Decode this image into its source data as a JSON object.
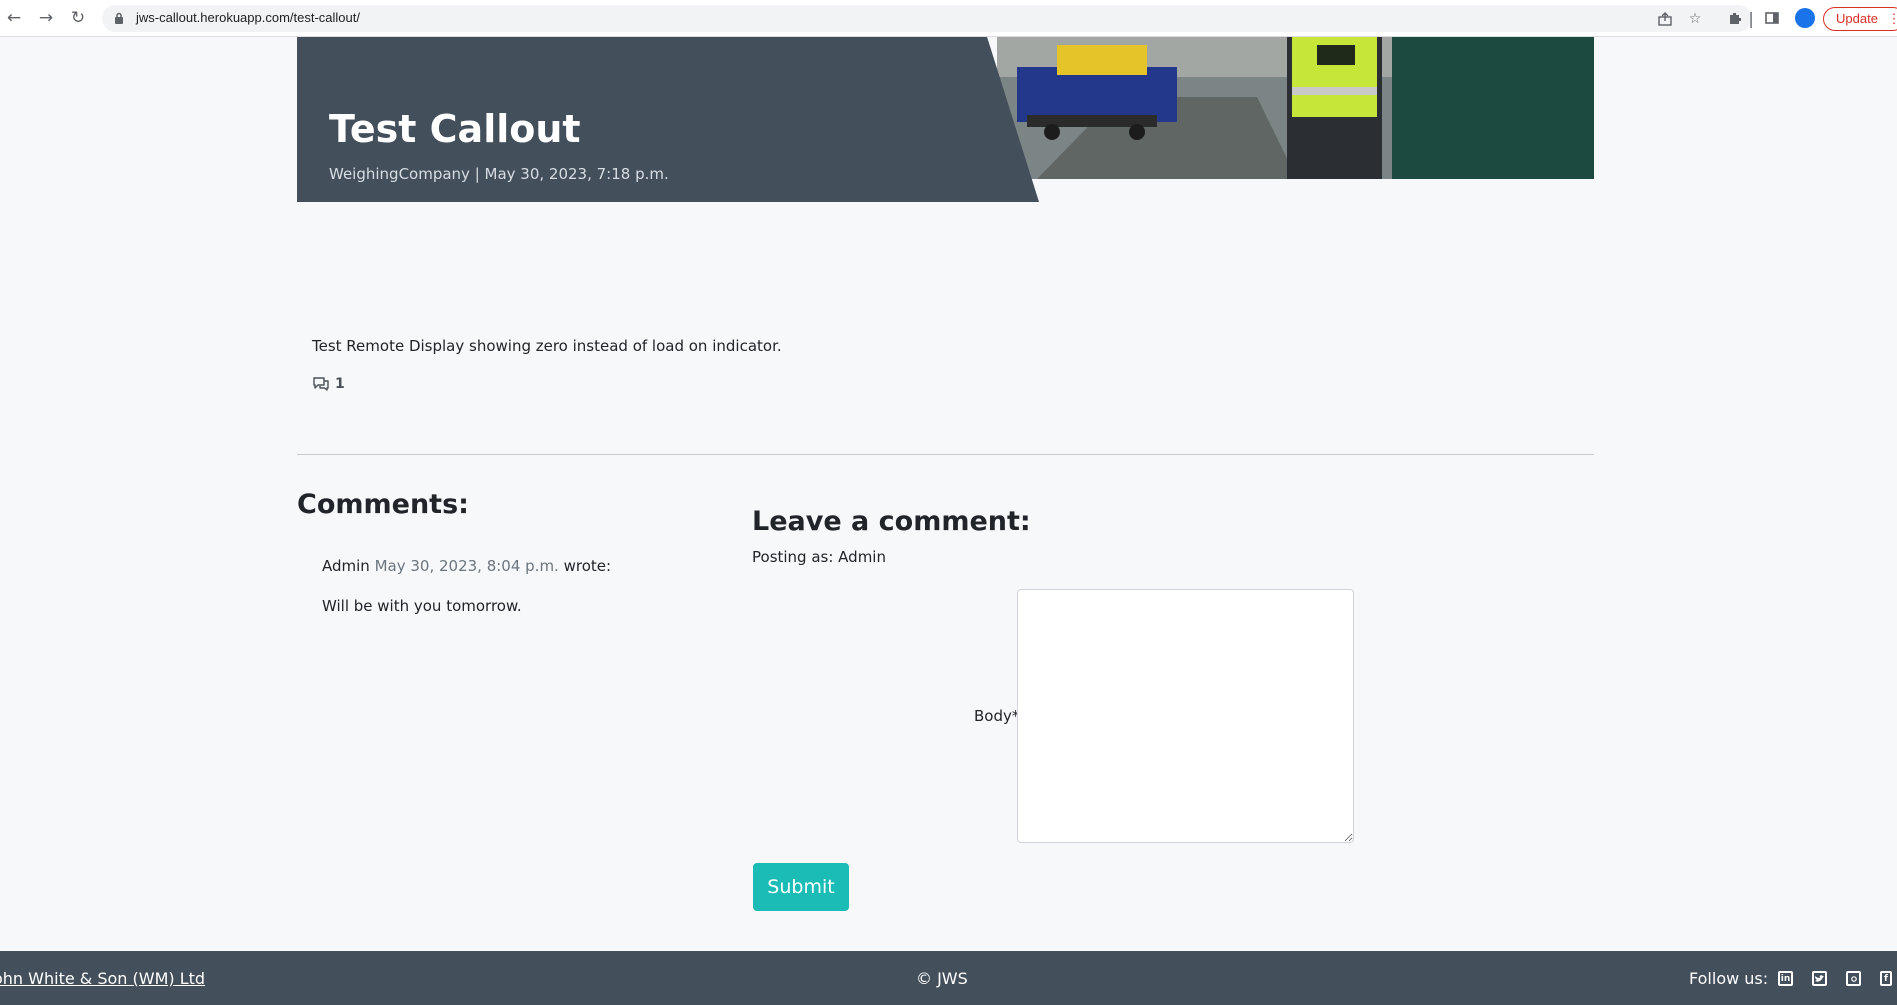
{
  "browser": {
    "url": "jws-callout.herokuapp.com/test-callout/",
    "update_label": "Update",
    "icons": [
      "back-icon",
      "forward-icon",
      "reload-icon",
      "lock-icon",
      "share-icon",
      "star-icon",
      "extensions-icon",
      "sidepanel-icon",
      "profile-icon",
      "menu-icon"
    ]
  },
  "post": {
    "title": "Test Callout",
    "meta": "WeighingCompany | May 30, 2023, 7:18 p.m.",
    "body": "Test Remote Display showing zero instead of load on indicator.",
    "comment_count": "1"
  },
  "comments": {
    "heading": "Comments:",
    "items": [
      {
        "author": "Admin",
        "date": "May 30, 2023, 8:04 p.m.",
        "suffix": "wrote:",
        "body": "Will be with you tomorrow."
      }
    ]
  },
  "comment_form": {
    "heading": "Leave a comment:",
    "posting_as": "Posting as: Admin",
    "body_label": "Body*",
    "body_value": "",
    "submit_label": "Submit"
  },
  "footer": {
    "company": "ohn White & Son (WM) Ltd",
    "copyright": "© JWS",
    "follow_label": "Follow us:",
    "social": [
      "linkedin-icon",
      "twitter-icon",
      "instagram-icon",
      "facebook-icon"
    ]
  },
  "colors": {
    "header_bg": "#434f5b",
    "accent": "#1bbcb6",
    "page_bg": "#f7f8fa"
  }
}
